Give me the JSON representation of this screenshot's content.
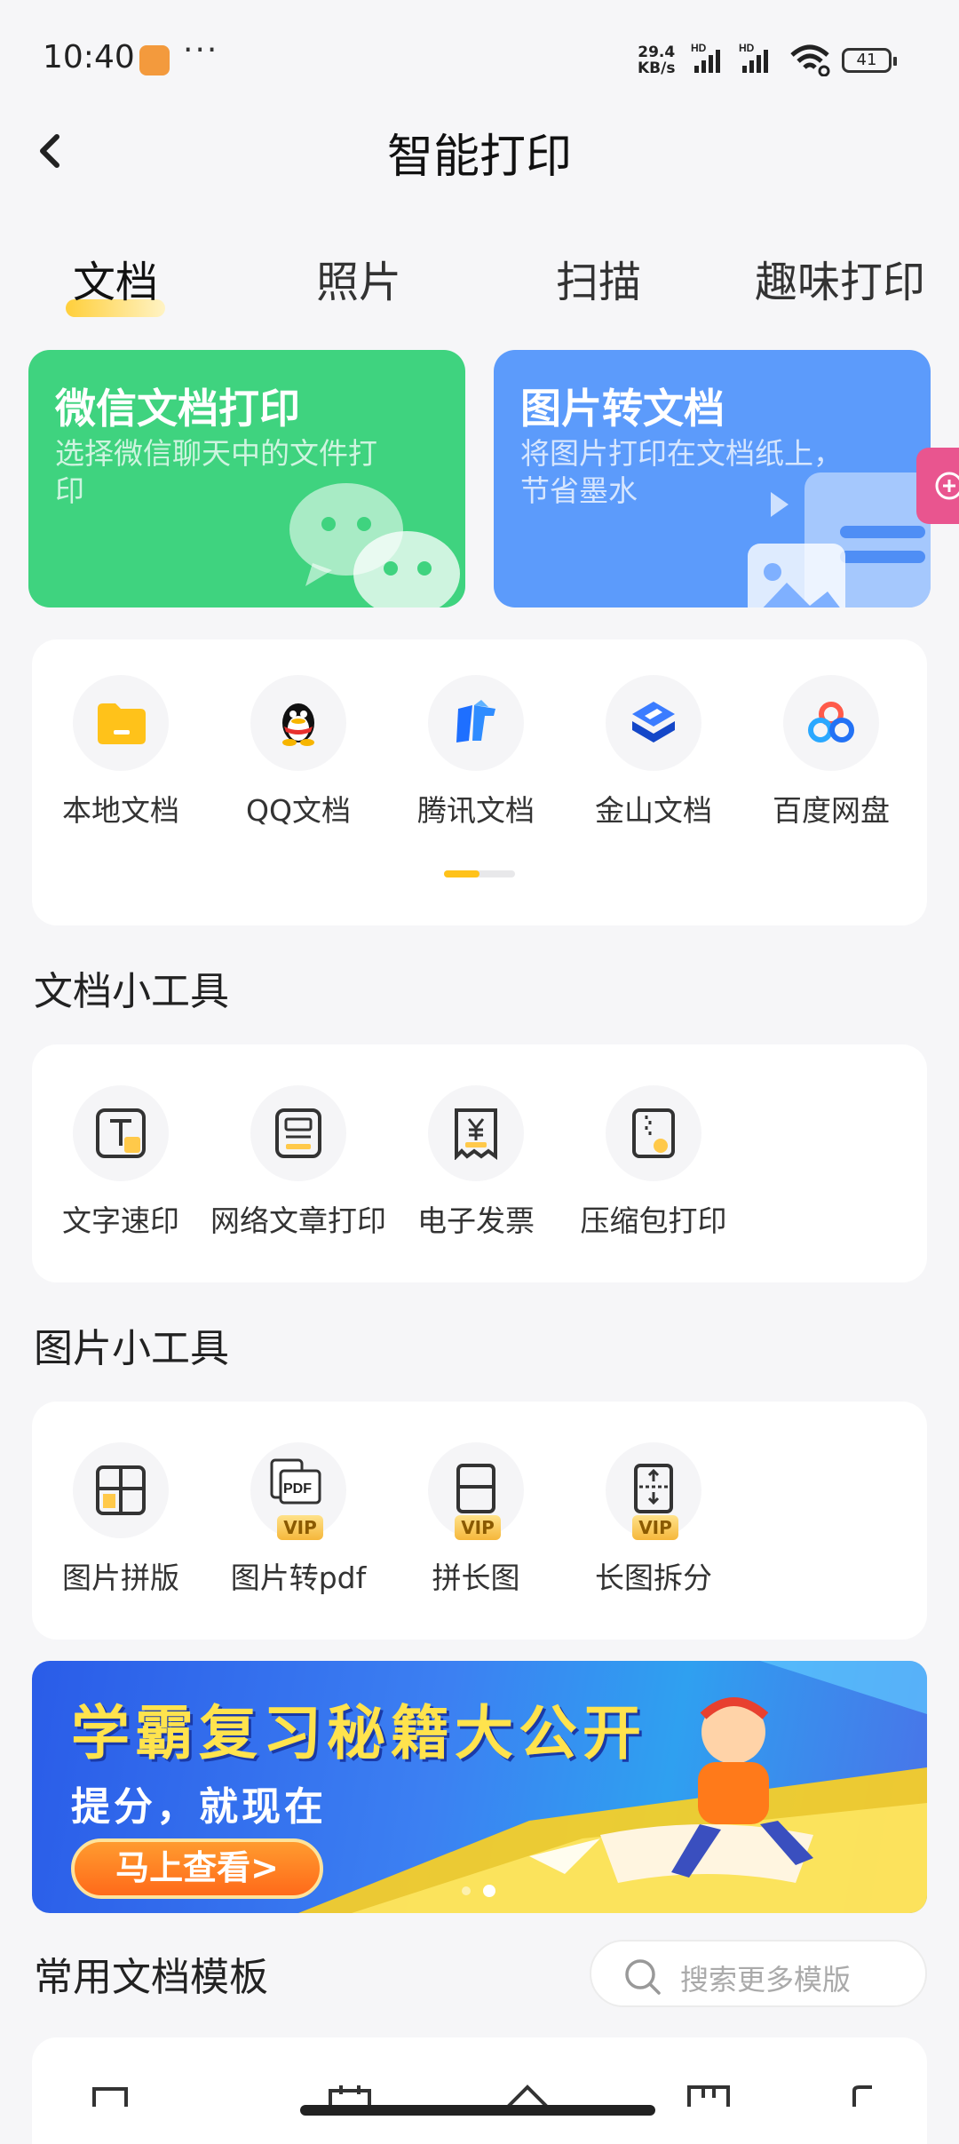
{
  "status": {
    "time": "10:40",
    "net_speed_value": "29.4",
    "net_speed_unit": "KB/s",
    "hd1": "HD",
    "hd2": "HD",
    "battery": "41"
  },
  "header": {
    "title": "智能打印"
  },
  "tabs": [
    {
      "label": "文档",
      "active": true
    },
    {
      "label": "照片",
      "active": false
    },
    {
      "label": "扫描",
      "active": false
    },
    {
      "label": "趣味打印",
      "active": false
    }
  ],
  "feature_cards": [
    {
      "title": "微信文档打印",
      "subtitle": "选择微信聊天中的文件打印",
      "color": "#3fd37f",
      "icon": "wechat-icon"
    },
    {
      "title": "图片转文档",
      "subtitle": "将图片打印在文档纸上，节省墨水",
      "color": "#5c9bfb",
      "icon": "document-image-icon"
    }
  ],
  "sources": [
    {
      "label": "本地文档",
      "icon": "folder-icon"
    },
    {
      "label": "QQ文档",
      "icon": "qq-penguin-icon"
    },
    {
      "label": "腾讯文档",
      "icon": "tencent-docs-icon"
    },
    {
      "label": "金山文档",
      "icon": "kingsoft-docs-icon"
    },
    {
      "label": "百度网盘",
      "icon": "baidu-netdisk-icon"
    }
  ],
  "doc_tools": {
    "title": "文档小工具",
    "items": [
      {
        "label": "文字速印",
        "icon": "text-print-icon"
      },
      {
        "label": "网络文章打印",
        "icon": "article-print-icon"
      },
      {
        "label": "电子发票",
        "icon": "invoice-icon"
      },
      {
        "label": "压缩包打印",
        "icon": "zip-print-icon"
      }
    ]
  },
  "image_tools": {
    "title": "图片小工具",
    "items": [
      {
        "label": "图片拼版",
        "icon": "image-collage-icon",
        "vip": false
      },
      {
        "label": "图片转pdf",
        "icon": "image-to-pdf-icon",
        "vip": true,
        "badge": "VIP",
        "icon_text": "PDF"
      },
      {
        "label": "拼长图",
        "icon": "long-image-stitch-icon",
        "vip": true,
        "badge": "VIP"
      },
      {
        "label": "长图拆分",
        "icon": "long-image-split-icon",
        "vip": true,
        "badge": "VIP"
      }
    ]
  },
  "banner": {
    "headline": "学霸复习秘籍大公开",
    "subline": "提分，就现在",
    "button": "马上查看>"
  },
  "templates": {
    "title": "常用文档模板",
    "search_placeholder": "搜索更多模版"
  },
  "colors": {
    "accent_yellow": "#ffcf3b",
    "wechat_green": "#3fd37f",
    "blue": "#5c9bfb",
    "pink": "#e9558f"
  }
}
